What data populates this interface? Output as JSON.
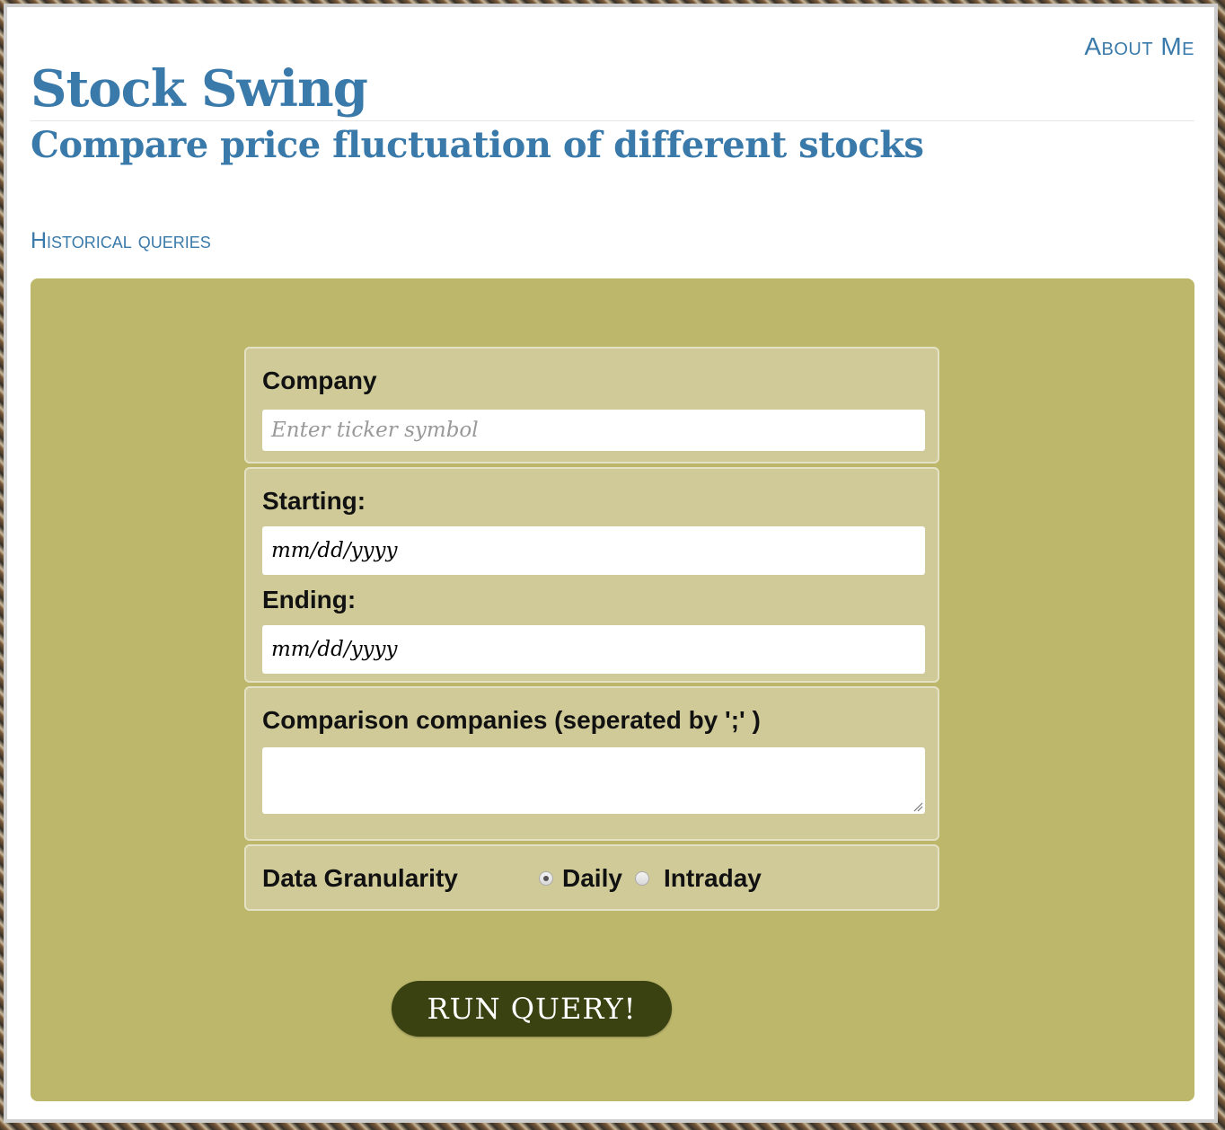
{
  "nav": {
    "about_label": "About Me"
  },
  "header": {
    "title": "Stock Swing",
    "subtitle": "Compare price fluctuation of different stocks"
  },
  "section": {
    "historical_label": "Historical queries"
  },
  "form": {
    "company": {
      "label": "Company",
      "placeholder": "Enter ticker symbol",
      "value": ""
    },
    "dates": {
      "starting_label": "Starting:",
      "starting_value": "mm/dd/yyyy",
      "ending_label": "Ending:",
      "ending_value": "mm/dd/yyyy"
    },
    "comparison": {
      "label": "Comparison companies (seperated by ';' )",
      "value": ""
    },
    "granularity": {
      "label": "Data Granularity",
      "options": [
        {
          "label": "Daily",
          "selected": true
        },
        {
          "label": "Intraday",
          "selected": false
        }
      ]
    },
    "submit_label": "RUN QUERY!"
  },
  "colors": {
    "accent": "#3a7aaa",
    "panel": "#bdb76b",
    "fieldset": "#cfca98",
    "button": "#3a4212"
  }
}
